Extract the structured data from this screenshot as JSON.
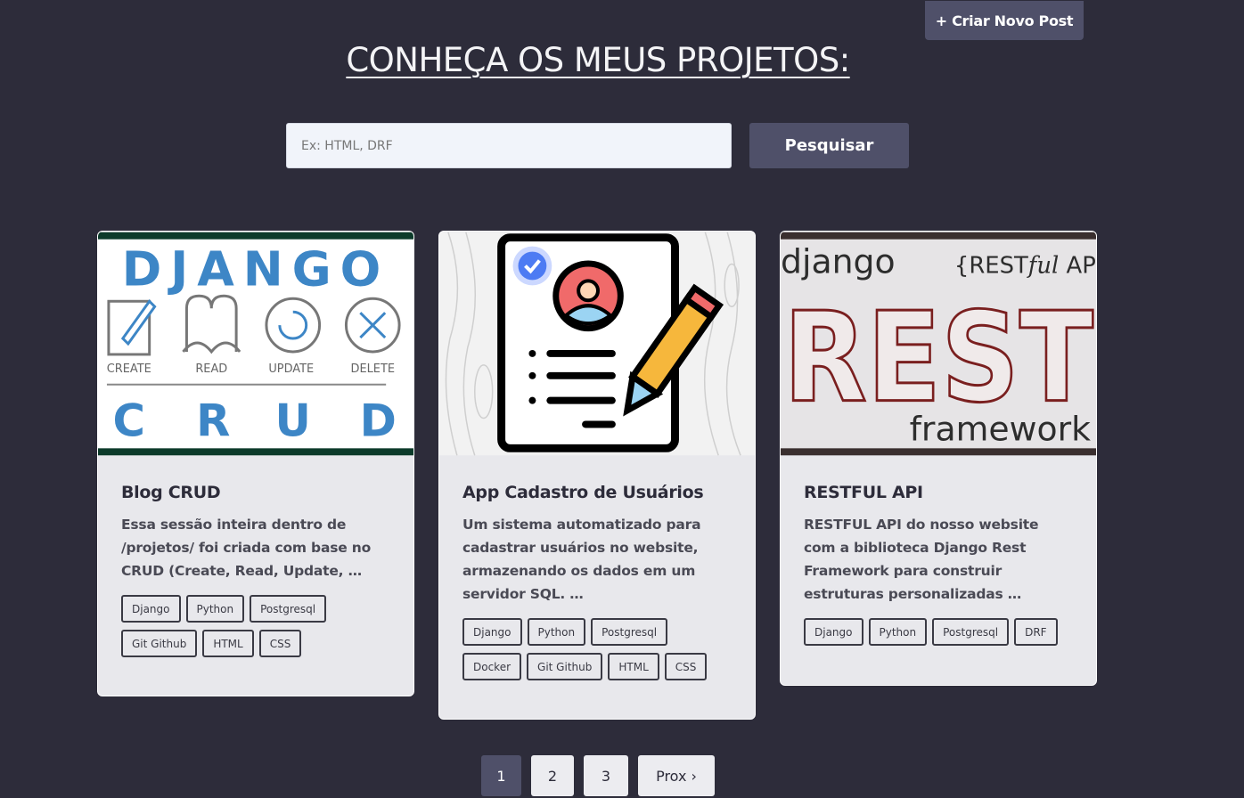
{
  "header": {
    "new_post_label": "+ Criar Novo Post",
    "title": "CONHEÇA OS MEUS PROJETOS:"
  },
  "search": {
    "placeholder": "Ex: HTML, DRF",
    "button_label": "Pesquisar"
  },
  "cards": [
    {
      "image": {
        "top_word": "DJANGO",
        "ops": [
          "CREATE",
          "READ",
          "UPDATE",
          "DELETE"
        ],
        "letters": [
          "C",
          "R",
          "U",
          "D"
        ]
      },
      "title": "Blog CRUD",
      "description": "Essa sessão inteira dentro de /projetos/ foi criada com base no CRUD (Create, Read, Update, …",
      "tags": [
        "Django",
        "Python",
        "Postgresql",
        "Git Github",
        "HTML",
        "CSS"
      ]
    },
    {
      "title": "App Cadastro de Usuários",
      "description": "Um sistema automatizado para cadastrar usuários no website, armazenando os dados em um servidor SQL. …",
      "tags": [
        "Django",
        "Python",
        "Postgresql",
        "Docker",
        "Git Github",
        "HTML",
        "CSS"
      ]
    },
    {
      "image": {
        "left_word": "django",
        "right_prefix": "{REST",
        "right_italic": "ful",
        "right_suffix": " AP",
        "big_word": "REST",
        "bottom_word": "framework"
      },
      "title": "RESTFUL API",
      "description": "RESTFUL API do nosso website com a biblioteca Django Rest Framework para construir estruturas personalizadas …",
      "tags": [
        "Django",
        "Python",
        "Postgresql",
        "DRF"
      ]
    }
  ],
  "pagination": {
    "pages": [
      "1",
      "2",
      "3"
    ],
    "active": "1",
    "next_label": "Prox ›"
  },
  "colors": {
    "background": "#2d2c3a",
    "button": "#4f5069",
    "card": "#e8e8ec",
    "django_blue": "#3d86c6",
    "rest_red": "#7a1f1f"
  }
}
